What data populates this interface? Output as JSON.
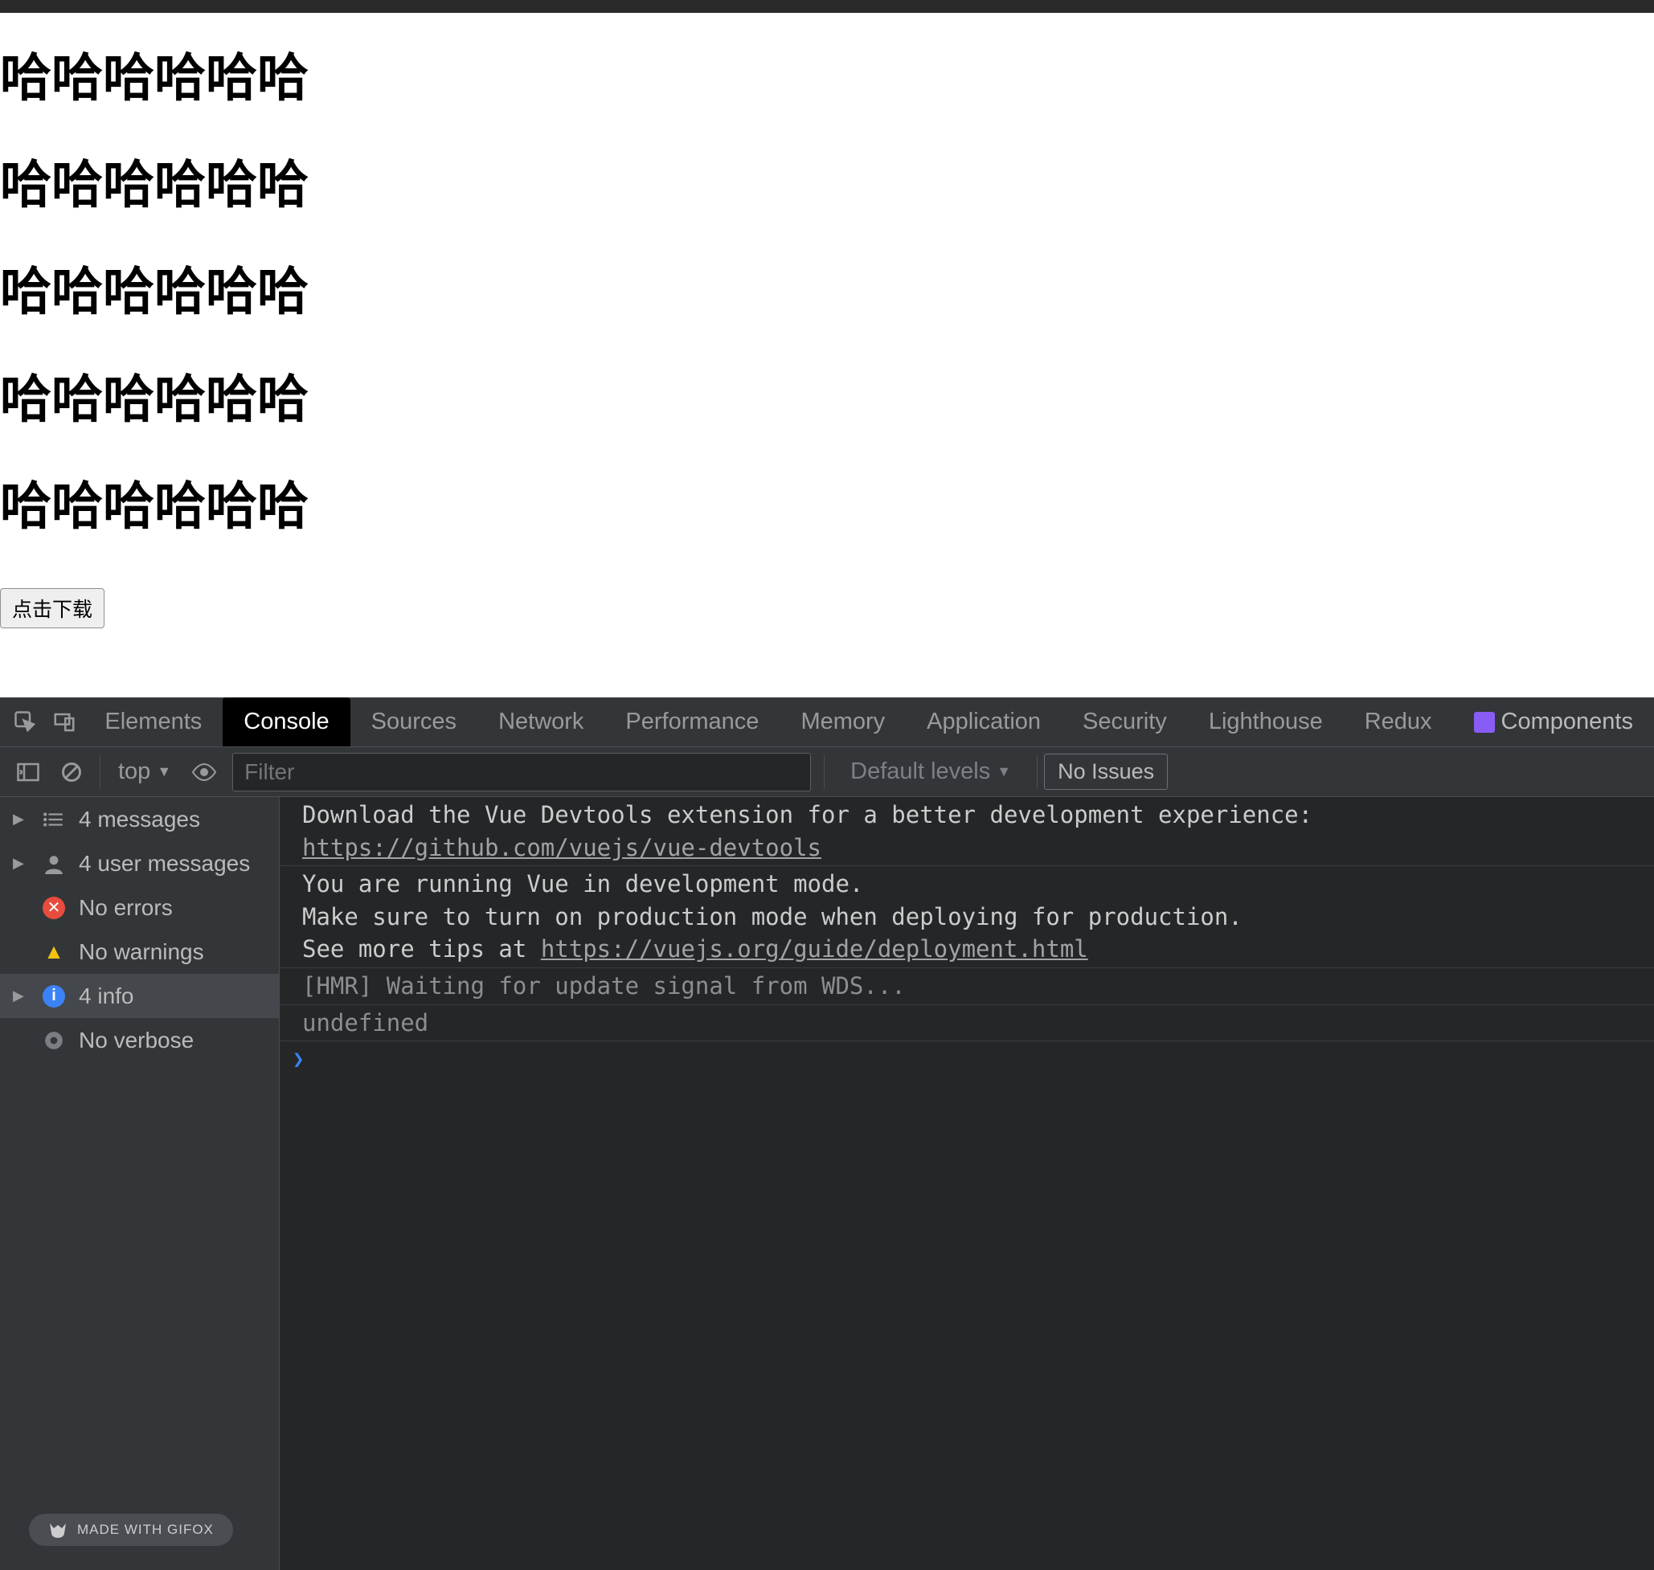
{
  "page": {
    "headings": [
      "哈哈哈哈哈哈",
      "哈哈哈哈哈哈",
      "哈哈哈哈哈哈",
      "哈哈哈哈哈哈",
      "哈哈哈哈哈哈"
    ],
    "download_label": "点击下载"
  },
  "devtools": {
    "tabs": {
      "elements": "Elements",
      "console": "Console",
      "sources": "Sources",
      "network": "Network",
      "performance": "Performance",
      "memory": "Memory",
      "application": "Application",
      "security": "Security",
      "lighthouse": "Lighthouse",
      "redux": "Redux",
      "components": "Components"
    },
    "toolbar": {
      "context": "top",
      "filter_placeholder": "Filter",
      "levels": "Default levels",
      "issues": "No Issues"
    },
    "sidebar": {
      "messages": "4 messages",
      "user_messages": "4 user messages",
      "errors": "No errors",
      "warnings": "No warnings",
      "info": "4 info",
      "verbose": "No verbose"
    },
    "console_messages": {
      "m0_text": "Download the Vue Devtools extension for a better development experience:",
      "m0_link": "https://github.com/vuejs/vue-devtools",
      "m1_text_a": "You are running Vue in development mode.",
      "m1_text_b": "Make sure to turn on production mode when deploying for production.",
      "m1_text_c": "See more tips at ",
      "m1_link": "https://vuejs.org/guide/deployment.html",
      "m2_text": "[HMR] Waiting for update signal from WDS...",
      "m3_text": "undefined"
    },
    "badge": "MADE WITH GIFOX"
  }
}
